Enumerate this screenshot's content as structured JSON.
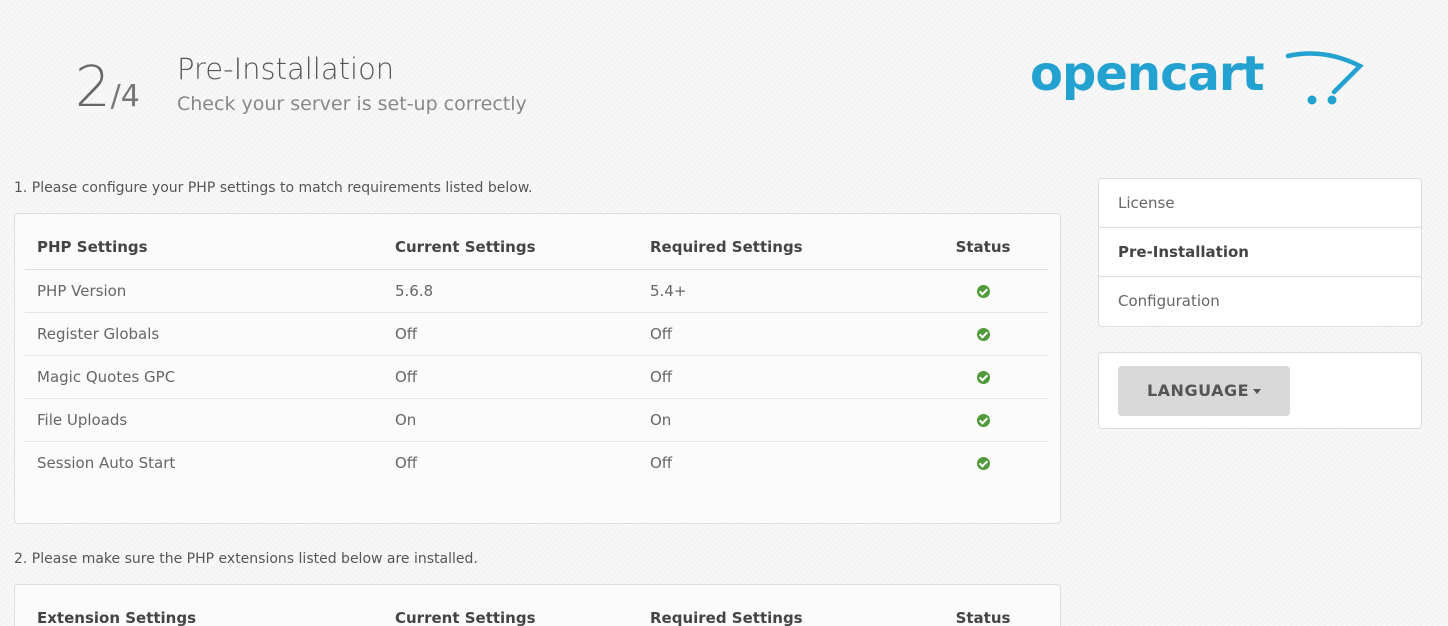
{
  "header": {
    "step_current": "2",
    "step_total": "/4",
    "title": "Pre-Installation",
    "subtitle": "Check your server is set-up correctly",
    "logo_text": "opencart",
    "logo_icon": "cart-icon"
  },
  "section1": {
    "instruction": "1. Please configure your PHP settings to match requirements listed below.",
    "headers": [
      "PHP Settings",
      "Current Settings",
      "Required Settings",
      "Status"
    ],
    "rows": [
      {
        "name": "PHP Version",
        "current": "5.6.8",
        "required": "5.4+",
        "status": "ok"
      },
      {
        "name": "Register Globals",
        "current": "Off",
        "required": "Off",
        "status": "ok"
      },
      {
        "name": "Magic Quotes GPC",
        "current": "Off",
        "required": "Off",
        "status": "ok"
      },
      {
        "name": "File Uploads",
        "current": "On",
        "required": "On",
        "status": "ok"
      },
      {
        "name": "Session Auto Start",
        "current": "Off",
        "required": "Off",
        "status": "ok"
      }
    ]
  },
  "section2": {
    "instruction": "2. Please make sure the PHP extensions listed below are installed.",
    "headers": [
      "Extension Settings",
      "Current Settings",
      "Required Settings",
      "Status"
    ]
  },
  "sidebar": {
    "items": [
      {
        "label": "License",
        "active": false
      },
      {
        "label": "Pre-Installation",
        "active": true
      },
      {
        "label": "Configuration",
        "active": false
      }
    ],
    "language_label": "LANGUAGE"
  },
  "colors": {
    "brand": "#23a1d1",
    "status_ok": "#4f9a3a"
  }
}
